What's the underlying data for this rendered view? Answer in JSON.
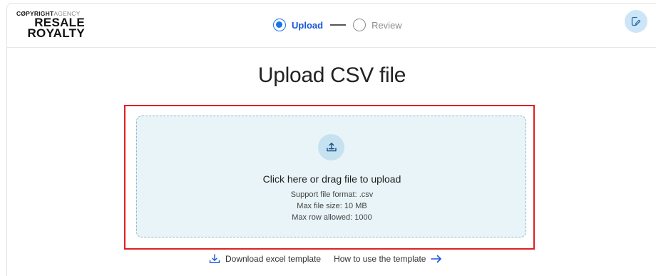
{
  "brand": {
    "line1_dark": "CØPYRIGHT",
    "line1_light": "AGENCY",
    "line2": "RESALE",
    "line3": "ROYALTY"
  },
  "stepper": {
    "steps": [
      {
        "label": "Upload",
        "active": true
      },
      {
        "label": "Review",
        "active": false
      }
    ]
  },
  "header": {
    "edit_icon": "edit-pencil-icon"
  },
  "main": {
    "title": "Upload CSV file"
  },
  "dropzone": {
    "icon": "upload-tray-icon",
    "title": "Click here or drag file to upload",
    "format": "Support file format: .csv",
    "max_size": "Max file size: 10 MB",
    "max_rows": "Max row allowed: 1000"
  },
  "links": {
    "download_label": "Download excel template",
    "howto_label": "How to use the template"
  },
  "colors": {
    "accent": "#1a56db",
    "highlight_border": "#e01f1f",
    "dropzone_bg": "#e8f4f7",
    "edit_button_bg": "#cde6f7"
  }
}
